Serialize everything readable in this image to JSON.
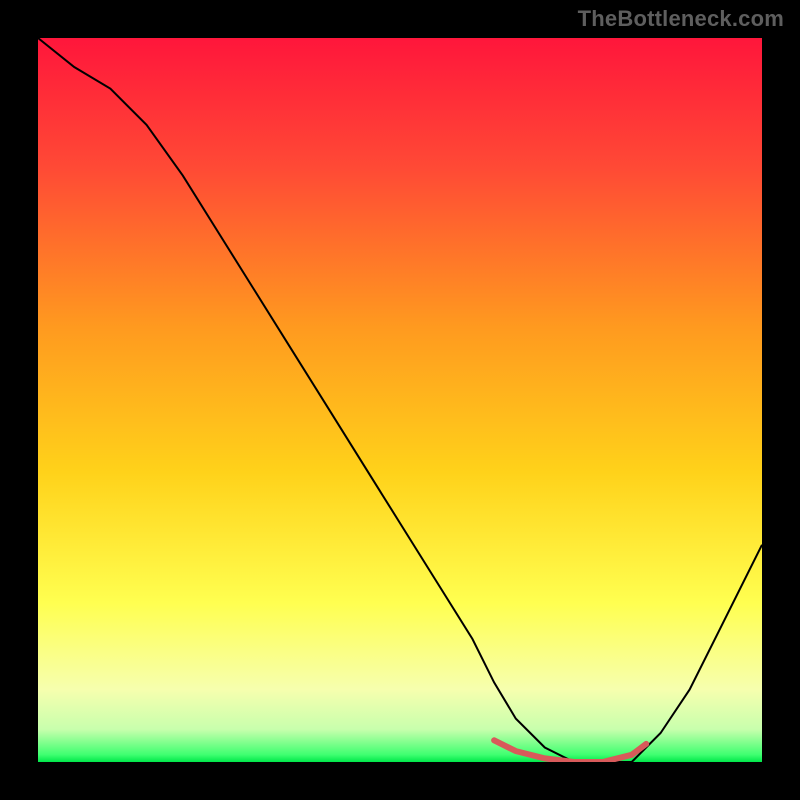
{
  "watermark": "TheBottleneck.com",
  "chart_data": {
    "type": "line",
    "title": "",
    "xlabel": "",
    "ylabel": "",
    "xlim": [
      0,
      100
    ],
    "ylim": [
      0,
      100
    ],
    "legend": null,
    "background": {
      "top_color": "#ff1a3a",
      "upper_mid_color": "#ffd21a",
      "lower_mid_color": "#ffff50",
      "bottom_color": "#00e74a"
    },
    "series": [
      {
        "name": "bottleneck-curve",
        "color": "#000000",
        "stroke_width": 2,
        "x": [
          0,
          5,
          10,
          15,
          20,
          25,
          30,
          35,
          40,
          45,
          50,
          55,
          60,
          63,
          66,
          70,
          74,
          78,
          82,
          86,
          90,
          94,
          98,
          100
        ],
        "values": [
          100,
          96,
          93,
          88,
          81,
          73,
          65,
          57,
          49,
          41,
          33,
          25,
          17,
          11,
          6,
          2,
          0,
          0,
          0,
          4,
          10,
          18,
          26,
          30
        ]
      },
      {
        "name": "optimum-marker",
        "color": "#d85a5a",
        "stroke_width": 6,
        "x": [
          63,
          66,
          70,
          74,
          78,
          82,
          84
        ],
        "values": [
          3,
          1.5,
          0.5,
          0,
          0,
          1,
          2.5
        ]
      }
    ],
    "gradient_bands": [
      {
        "offset": 0.0,
        "color": "#ff163b"
      },
      {
        "offset": 0.18,
        "color": "#ff4a35"
      },
      {
        "offset": 0.4,
        "color": "#ff9a1f"
      },
      {
        "offset": 0.6,
        "color": "#ffd21a"
      },
      {
        "offset": 0.78,
        "color": "#ffff50"
      },
      {
        "offset": 0.9,
        "color": "#f6ffae"
      },
      {
        "offset": 0.955,
        "color": "#c8ffad"
      },
      {
        "offset": 0.99,
        "color": "#3fff70"
      },
      {
        "offset": 1.0,
        "color": "#00e74a"
      }
    ]
  }
}
